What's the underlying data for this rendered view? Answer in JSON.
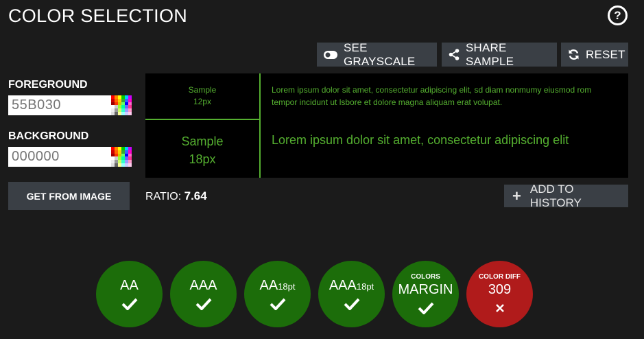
{
  "header": {
    "title": "COLOR SELECTION",
    "help_glyph": "?"
  },
  "toolbar": {
    "grayscale_label": "SEE GRAYSCALE",
    "share_label": "SHARE SAMPLE",
    "reset_label": "RESET"
  },
  "foreground": {
    "label": "FOREGROUND",
    "value": "",
    "placeholder": "55B030"
  },
  "background": {
    "label": "BACKGROUND",
    "value": "",
    "placeholder": "000000"
  },
  "get_from_image_label": "GET FROM IMAGE",
  "sample": {
    "small_label_line1": "Sample",
    "small_label_line2": "12px",
    "large_label_line1": "Sample",
    "large_label_line2": "18px",
    "small_text": "Lorem ipsum dolor sit amet, consectetur adipiscing elit, sd diam nonmumy eiusmod rom tempor incidunt ut lsbore et dolore magna aliquam erat volupat.",
    "large_text": "Lorem ipsum dolor sit amet, consectetur adipiscing elit"
  },
  "ratio": {
    "label": "RATIO:",
    "value": "7.64"
  },
  "add_to_history_label": "ADD TO HISTORY",
  "badges": [
    {
      "main": "AA",
      "sub": "",
      "top": "",
      "status": "pass"
    },
    {
      "main": "AAA",
      "sub": "",
      "top": "",
      "status": "pass"
    },
    {
      "main": "AA",
      "sub": "18pt",
      "top": "",
      "status": "pass"
    },
    {
      "main": "AAA",
      "sub": "18pt",
      "top": "",
      "status": "pass"
    },
    {
      "main": "MARGIN",
      "sub": "",
      "top": "COLORS",
      "status": "pass"
    },
    {
      "main": "309",
      "sub": "",
      "top": "COLOR DIFF",
      "status": "fail"
    }
  ],
  "colors": {
    "page_bg": "#1b1b1b",
    "button_bg": "#3a3f45",
    "foreground_sample": "#55b030",
    "background_sample": "#000000",
    "pass": "#1c6d0a",
    "fail": "#b01b1b"
  },
  "icons": {
    "help": "question-circle-icon",
    "grayscale": "toggle-icon",
    "share": "share-icon",
    "reset": "refresh-icon",
    "add": "plus-icon",
    "pass": "checkmark-icon",
    "fail": "cross-icon"
  }
}
